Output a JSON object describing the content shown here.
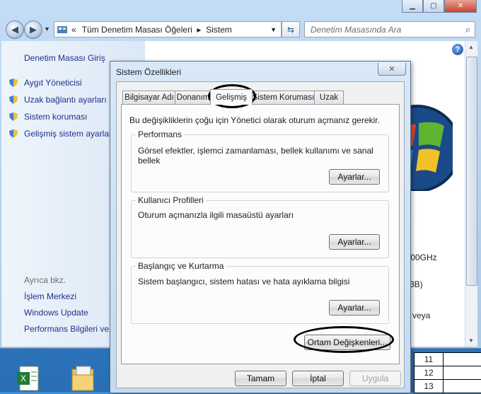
{
  "window": {
    "address_prefix": "«",
    "address": "Tüm Denetim Masası Öğeleri  ▸  Sistem",
    "search_placeholder": "Denetim Masasında Ara"
  },
  "sidebar": {
    "home": "Denetim Masası Giriş",
    "items": [
      {
        "label": "Aygıt Yöneticisi"
      },
      {
        "label": "Uzak bağlantı ayarları"
      },
      {
        "label": "Sistem koruması"
      },
      {
        "label": "Gelişmiş sistem ayarları"
      }
    ],
    "see_also": "Ayrıca bkz.",
    "links": [
      {
        "label": "İşlem Merkezi"
      },
      {
        "label": "Windows Update"
      },
      {
        "label": "Performans Bilgileri ve"
      }
    ]
  },
  "background_fragments": {
    "cpu": ".00GHz",
    "ram": "3B)",
    "touch": "i veya"
  },
  "table_rows": [
    "11",
    "12",
    "13"
  ],
  "dialog": {
    "title": "Sistem Özellikleri",
    "tabs": [
      {
        "label": "Bilgisayar Adı"
      },
      {
        "label": "Donanım"
      },
      {
        "label": "Gelişmiş"
      },
      {
        "label": "Sistem Koruması"
      },
      {
        "label": "Uzak"
      }
    ],
    "note": "Bu değişikliklerin çoğu için Yönetici olarak oturum açmanız gerekir.",
    "performance": {
      "title": "Performans",
      "text": "Görsel efektler, işlemci zamanlaması, bellek kullanımı ve sanal bellek",
      "button": "Ayarlar..."
    },
    "profiles": {
      "title": "Kullanıcı Profilleri",
      "text": "Oturum açmanızla ilgili masaüstü ayarları",
      "button": "Ayarlar..."
    },
    "startup": {
      "title": "Başlangıç ve Kurtarma",
      "text": "Sistem başlangıcı, sistem hatası ve hata ayıklama bilgisi",
      "button": "Ayarlar..."
    },
    "env_button": "Ortam Değişkenleri...",
    "ok": "Tamam",
    "cancel": "İptal",
    "apply": "Uygula"
  }
}
